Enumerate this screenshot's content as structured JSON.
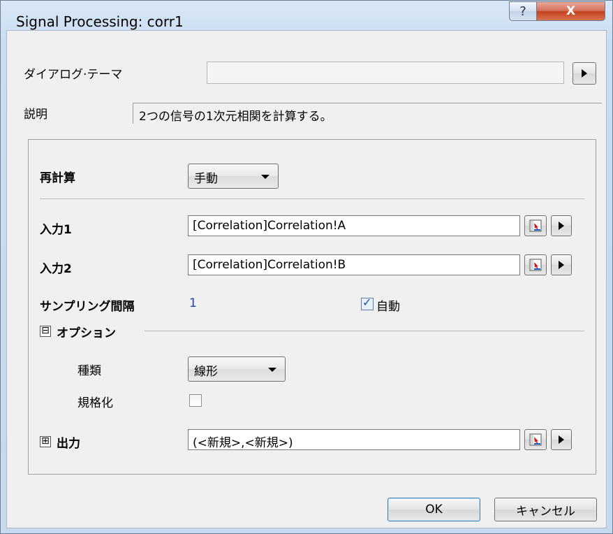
{
  "window": {
    "title": "Signal Processing: corr1",
    "help_glyph": "?",
    "close_glyph": "X"
  },
  "theme": {
    "label": "ダイアログ·テーマ",
    "value": ""
  },
  "description": {
    "label": "説明",
    "text": "2つの信号の1次元相関を計算する。"
  },
  "recalc": {
    "label": "再計算",
    "value": "手動"
  },
  "input1": {
    "label": "入力1",
    "value": "[Correlation]Correlation!A"
  },
  "input2": {
    "label": "入力2",
    "value": "[Correlation]Correlation!B"
  },
  "sampling": {
    "label": "サンプリング間隔",
    "value": "1",
    "auto_label": "自動",
    "auto_checked": true
  },
  "options": {
    "toggle_glyph": "⊟",
    "label": "オプション",
    "type_label": "種類",
    "type_value": "線形",
    "normalize_label": "規格化",
    "normalize_checked": false
  },
  "output": {
    "toggle_glyph": "⊞",
    "label": "出力",
    "value": "(<新規>,<新規>)"
  },
  "footer": {
    "ok_label": "OK",
    "cancel_label": "キャンセル"
  },
  "colors": {
    "sampling_value": "#1f3fbf",
    "titlebar": "#c9dcf0",
    "close_button": "#c2411f"
  }
}
